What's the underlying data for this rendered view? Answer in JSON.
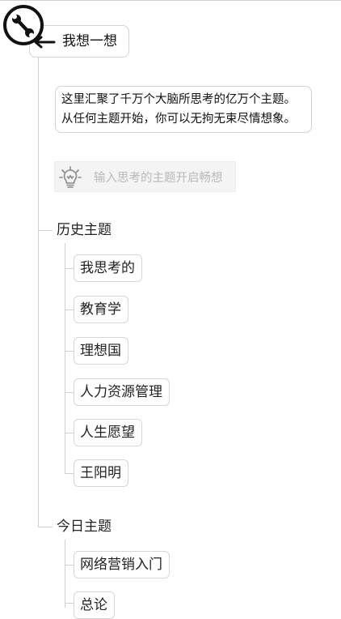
{
  "header": {
    "title": "我想一想"
  },
  "intro": {
    "line1": "这里汇聚了千万个大脑所思考的亿万个主题。",
    "line2": "从任何主题开始，你可以无拘无束尽情想象。"
  },
  "idea_input": {
    "placeholder": "输入思考的主题开启畅想"
  },
  "history": {
    "heading": "历史主题",
    "items": [
      {
        "label": "我思考的"
      },
      {
        "label": "教育学"
      },
      {
        "label": "理想国"
      },
      {
        "label": "人力资源管理"
      },
      {
        "label": "人生愿望"
      },
      {
        "label": "王阳明"
      }
    ]
  },
  "today": {
    "heading": "今日主题",
    "items": [
      {
        "label": "网络营销入门"
      },
      {
        "label": "总论"
      }
    ]
  },
  "icons": {
    "tool": "wrench-icon",
    "back": "back-arrow-icon",
    "idea": "lightbulb-icon"
  }
}
